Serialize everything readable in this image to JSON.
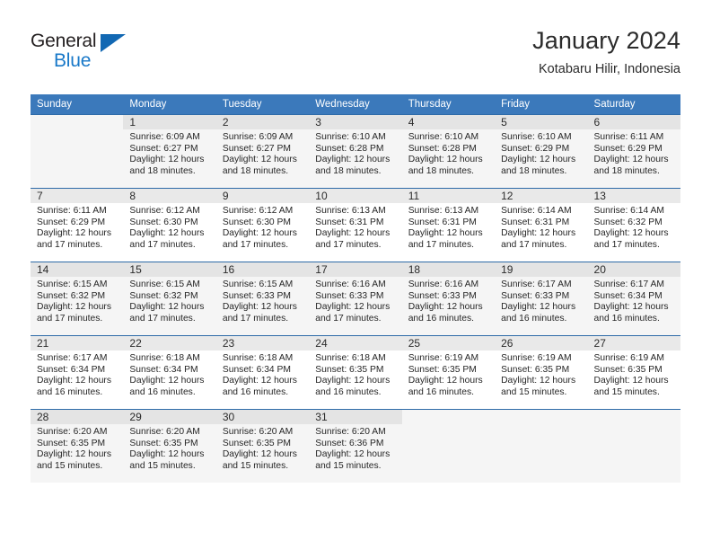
{
  "logo": {
    "word1": "General",
    "word2": "Blue",
    "icon": "triangle-icon",
    "colors": {
      "dark": "#231f20",
      "blue": "#1878c8",
      "triangle": "#1268b3"
    }
  },
  "header": {
    "title": "January 2024",
    "subtitle": "Kotabaru Hilir, Indonesia"
  },
  "theme": {
    "header_row_bg": "#3b79bb",
    "header_row_text": "#ffffff",
    "daynum_bg": "#e9e9e9",
    "shaded_row_bg": "#f5f5f5"
  },
  "calendar": {
    "weekday_headers": [
      "Sunday",
      "Monday",
      "Tuesday",
      "Wednesday",
      "Thursday",
      "Friday",
      "Saturday"
    ],
    "weeks": [
      [
        {
          "day": "",
          "sunrise": "",
          "sunset": "",
          "daylight1": "",
          "daylight2": "",
          "empty": true
        },
        {
          "day": "1",
          "sunrise": "Sunrise: 6:09 AM",
          "sunset": "Sunset: 6:27 PM",
          "daylight1": "Daylight: 12 hours",
          "daylight2": "and 18 minutes."
        },
        {
          "day": "2",
          "sunrise": "Sunrise: 6:09 AM",
          "sunset": "Sunset: 6:27 PM",
          "daylight1": "Daylight: 12 hours",
          "daylight2": "and 18 minutes."
        },
        {
          "day": "3",
          "sunrise": "Sunrise: 6:10 AM",
          "sunset": "Sunset: 6:28 PM",
          "daylight1": "Daylight: 12 hours",
          "daylight2": "and 18 minutes."
        },
        {
          "day": "4",
          "sunrise": "Sunrise: 6:10 AM",
          "sunset": "Sunset: 6:28 PM",
          "daylight1": "Daylight: 12 hours",
          "daylight2": "and 18 minutes."
        },
        {
          "day": "5",
          "sunrise": "Sunrise: 6:10 AM",
          "sunset": "Sunset: 6:29 PM",
          "daylight1": "Daylight: 12 hours",
          "daylight2": "and 18 minutes."
        },
        {
          "day": "6",
          "sunrise": "Sunrise: 6:11 AM",
          "sunset": "Sunset: 6:29 PM",
          "daylight1": "Daylight: 12 hours",
          "daylight2": "and 18 minutes."
        }
      ],
      [
        {
          "day": "7",
          "sunrise": "Sunrise: 6:11 AM",
          "sunset": "Sunset: 6:29 PM",
          "daylight1": "Daylight: 12 hours",
          "daylight2": "and 17 minutes."
        },
        {
          "day": "8",
          "sunrise": "Sunrise: 6:12 AM",
          "sunset": "Sunset: 6:30 PM",
          "daylight1": "Daylight: 12 hours",
          "daylight2": "and 17 minutes."
        },
        {
          "day": "9",
          "sunrise": "Sunrise: 6:12 AM",
          "sunset": "Sunset: 6:30 PM",
          "daylight1": "Daylight: 12 hours",
          "daylight2": "and 17 minutes."
        },
        {
          "day": "10",
          "sunrise": "Sunrise: 6:13 AM",
          "sunset": "Sunset: 6:31 PM",
          "daylight1": "Daylight: 12 hours",
          "daylight2": "and 17 minutes."
        },
        {
          "day": "11",
          "sunrise": "Sunrise: 6:13 AM",
          "sunset": "Sunset: 6:31 PM",
          "daylight1": "Daylight: 12 hours",
          "daylight2": "and 17 minutes."
        },
        {
          "day": "12",
          "sunrise": "Sunrise: 6:14 AM",
          "sunset": "Sunset: 6:31 PM",
          "daylight1": "Daylight: 12 hours",
          "daylight2": "and 17 minutes."
        },
        {
          "day": "13",
          "sunrise": "Sunrise: 6:14 AM",
          "sunset": "Sunset: 6:32 PM",
          "daylight1": "Daylight: 12 hours",
          "daylight2": "and 17 minutes."
        }
      ],
      [
        {
          "day": "14",
          "sunrise": "Sunrise: 6:15 AM",
          "sunset": "Sunset: 6:32 PM",
          "daylight1": "Daylight: 12 hours",
          "daylight2": "and 17 minutes."
        },
        {
          "day": "15",
          "sunrise": "Sunrise: 6:15 AM",
          "sunset": "Sunset: 6:32 PM",
          "daylight1": "Daylight: 12 hours",
          "daylight2": "and 17 minutes."
        },
        {
          "day": "16",
          "sunrise": "Sunrise: 6:15 AM",
          "sunset": "Sunset: 6:33 PM",
          "daylight1": "Daylight: 12 hours",
          "daylight2": "and 17 minutes."
        },
        {
          "day": "17",
          "sunrise": "Sunrise: 6:16 AM",
          "sunset": "Sunset: 6:33 PM",
          "daylight1": "Daylight: 12 hours",
          "daylight2": "and 17 minutes."
        },
        {
          "day": "18",
          "sunrise": "Sunrise: 6:16 AM",
          "sunset": "Sunset: 6:33 PM",
          "daylight1": "Daylight: 12 hours",
          "daylight2": "and 16 minutes."
        },
        {
          "day": "19",
          "sunrise": "Sunrise: 6:17 AM",
          "sunset": "Sunset: 6:33 PM",
          "daylight1": "Daylight: 12 hours",
          "daylight2": "and 16 minutes."
        },
        {
          "day": "20",
          "sunrise": "Sunrise: 6:17 AM",
          "sunset": "Sunset: 6:34 PM",
          "daylight1": "Daylight: 12 hours",
          "daylight2": "and 16 minutes."
        }
      ],
      [
        {
          "day": "21",
          "sunrise": "Sunrise: 6:17 AM",
          "sunset": "Sunset: 6:34 PM",
          "daylight1": "Daylight: 12 hours",
          "daylight2": "and 16 minutes."
        },
        {
          "day": "22",
          "sunrise": "Sunrise: 6:18 AM",
          "sunset": "Sunset: 6:34 PM",
          "daylight1": "Daylight: 12 hours",
          "daylight2": "and 16 minutes."
        },
        {
          "day": "23",
          "sunrise": "Sunrise: 6:18 AM",
          "sunset": "Sunset: 6:34 PM",
          "daylight1": "Daylight: 12 hours",
          "daylight2": "and 16 minutes."
        },
        {
          "day": "24",
          "sunrise": "Sunrise: 6:18 AM",
          "sunset": "Sunset: 6:35 PM",
          "daylight1": "Daylight: 12 hours",
          "daylight2": "and 16 minutes."
        },
        {
          "day": "25",
          "sunrise": "Sunrise: 6:19 AM",
          "sunset": "Sunset: 6:35 PM",
          "daylight1": "Daylight: 12 hours",
          "daylight2": "and 16 minutes."
        },
        {
          "day": "26",
          "sunrise": "Sunrise: 6:19 AM",
          "sunset": "Sunset: 6:35 PM",
          "daylight1": "Daylight: 12 hours",
          "daylight2": "and 15 minutes."
        },
        {
          "day": "27",
          "sunrise": "Sunrise: 6:19 AM",
          "sunset": "Sunset: 6:35 PM",
          "daylight1": "Daylight: 12 hours",
          "daylight2": "and 15 minutes."
        }
      ],
      [
        {
          "day": "28",
          "sunrise": "Sunrise: 6:20 AM",
          "sunset": "Sunset: 6:35 PM",
          "daylight1": "Daylight: 12 hours",
          "daylight2": "and 15 minutes."
        },
        {
          "day": "29",
          "sunrise": "Sunrise: 6:20 AM",
          "sunset": "Sunset: 6:35 PM",
          "daylight1": "Daylight: 12 hours",
          "daylight2": "and 15 minutes."
        },
        {
          "day": "30",
          "sunrise": "Sunrise: 6:20 AM",
          "sunset": "Sunset: 6:35 PM",
          "daylight1": "Daylight: 12 hours",
          "daylight2": "and 15 minutes."
        },
        {
          "day": "31",
          "sunrise": "Sunrise: 6:20 AM",
          "sunset": "Sunset: 6:36 PM",
          "daylight1": "Daylight: 12 hours",
          "daylight2": "and 15 minutes."
        },
        {
          "day": "",
          "sunrise": "",
          "sunset": "",
          "daylight1": "",
          "daylight2": "",
          "empty": true
        },
        {
          "day": "",
          "sunrise": "",
          "sunset": "",
          "daylight1": "",
          "daylight2": "",
          "empty": true
        },
        {
          "day": "",
          "sunrise": "",
          "sunset": "",
          "daylight1": "",
          "daylight2": "",
          "empty": true
        }
      ]
    ]
  }
}
